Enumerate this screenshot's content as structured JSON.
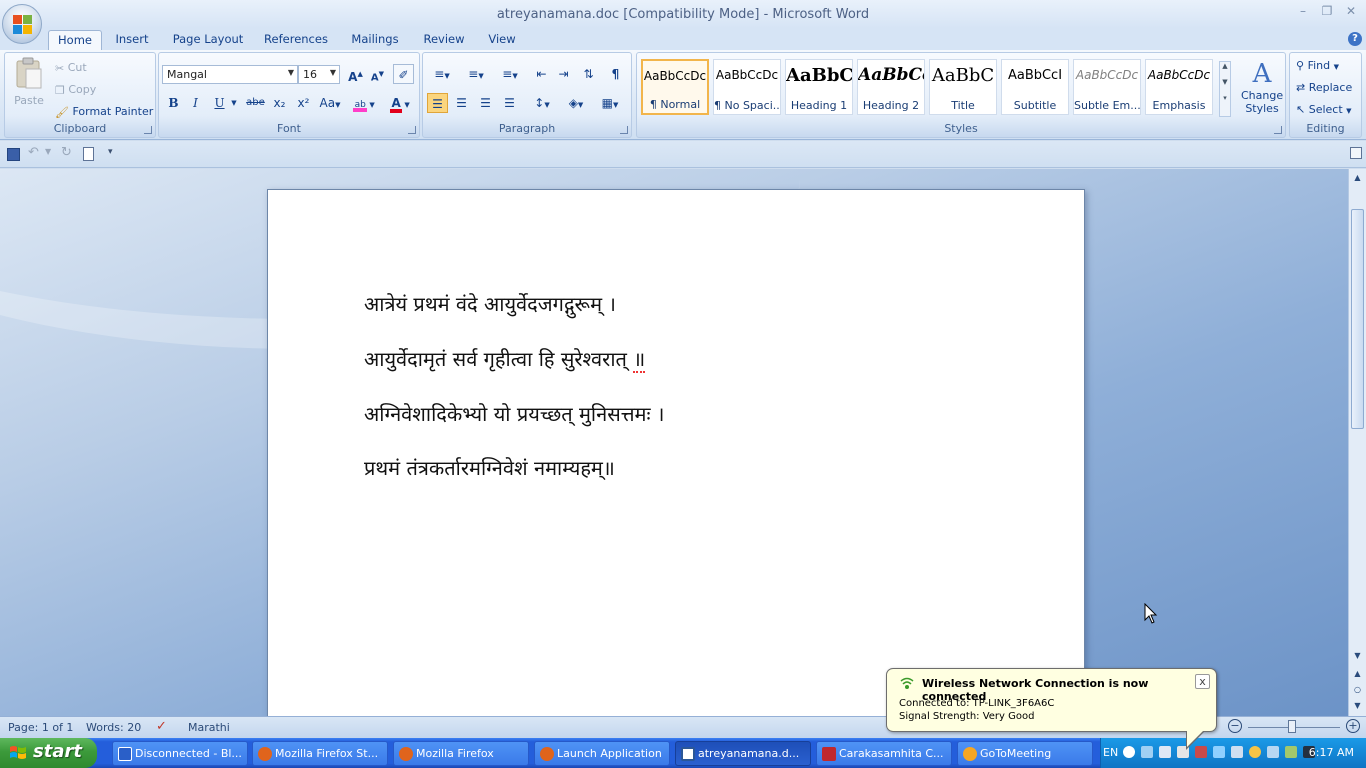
{
  "window": {
    "title": "atreyanamana.doc [Compatibility Mode] - Microsoft Word",
    "controls": [
      "minimize",
      "maximize",
      "close"
    ]
  },
  "tabs": [
    "Home",
    "Insert",
    "Page Layout",
    "References",
    "Mailings",
    "Review",
    "View"
  ],
  "active_tab": "Home",
  "ribbon": {
    "clipboard": {
      "label": "Clipboard",
      "paste": "Paste",
      "cut": "Cut",
      "copy": "Copy",
      "format_painter": "Format Painter"
    },
    "font": {
      "label": "Font",
      "family": "Mangal",
      "size": "16",
      "bold": "B",
      "italic": "I",
      "underline": "U",
      "strike": "abe",
      "subscript": "x₂",
      "superscript": "x²",
      "change_case": "Aa",
      "grow": "A",
      "shrink": "A"
    },
    "paragraph": {
      "label": "Paragraph",
      "show_marks": "¶"
    },
    "styles": {
      "label": "Styles",
      "items": [
        {
          "sample": "AaBbCcDc",
          "name": "¶ Normal"
        },
        {
          "sample": "AaBbCcDc",
          "name": "¶ No Spaci..."
        },
        {
          "sample": "AaBbC",
          "name": "Heading 1"
        },
        {
          "sample": "AaBbCc",
          "name": "Heading 2"
        },
        {
          "sample": "AaBbC",
          "name": "Title"
        },
        {
          "sample": "AaBbCcI",
          "name": "Subtitle"
        },
        {
          "sample": "AaBbCcDc",
          "name": "Subtle Em..."
        },
        {
          "sample": "AaBbCcDc",
          "name": "Emphasis"
        }
      ],
      "change_styles": "Change",
      "change_styles2": "Styles"
    },
    "editing": {
      "label": "Editing",
      "find": "Find",
      "replace": "Replace",
      "select": "Select"
    }
  },
  "document": {
    "lines": [
      "आत्रेयं प्रथमं वंदे आयुर्वेदजगद्गुरूम् ।",
      "आयुर्वेदामृतं सर्व गृहीत्वा हि सुरेश्वरात् ",
      "अग्निवेशादिकेभ्यो यो प्रयच्छत् मुनिसत्तमः ।",
      "प्रथमं तंत्रकर्तारमग्निवेशं नमाम्यहम्॥"
    ],
    "line2_end": "॥"
  },
  "statusbar": {
    "page": "Page: 1 of 1",
    "words": "Words: 20",
    "language": "Marathi"
  },
  "taskbar": {
    "start": "start",
    "tasks": [
      {
        "label": "Disconnected - Bl...",
        "color": "#2a5fc8"
      },
      {
        "label": "Mozilla Firefox St...",
        "color": "#e0641c"
      },
      {
        "label": "Mozilla Firefox",
        "color": "#e0641c"
      },
      {
        "label": "Launch Application",
        "color": "#e0641c"
      },
      {
        "label": "atreyanamana.d...",
        "color": "#2b5797"
      },
      {
        "label": "Carakasamhita C...",
        "color": "#c0282d"
      },
      {
        "label": "GoToMeeting",
        "color": "#f5a623"
      }
    ],
    "active_task": "atreyanamana.d...",
    "lang": "EN",
    "clock": "6:17 AM"
  },
  "balloon": {
    "title": "Wireless Network Connection is now connected",
    "line1": "Connected to: TP-LINK_3F6A6C",
    "line2": "Signal Strength: Very Good",
    "close": "x"
  },
  "colors": {
    "ribbon_bg": "#dce8f6",
    "taskbar": "#245edb",
    "start_green": "#3c9a3b",
    "balloon_bg": "#ffffe1"
  }
}
